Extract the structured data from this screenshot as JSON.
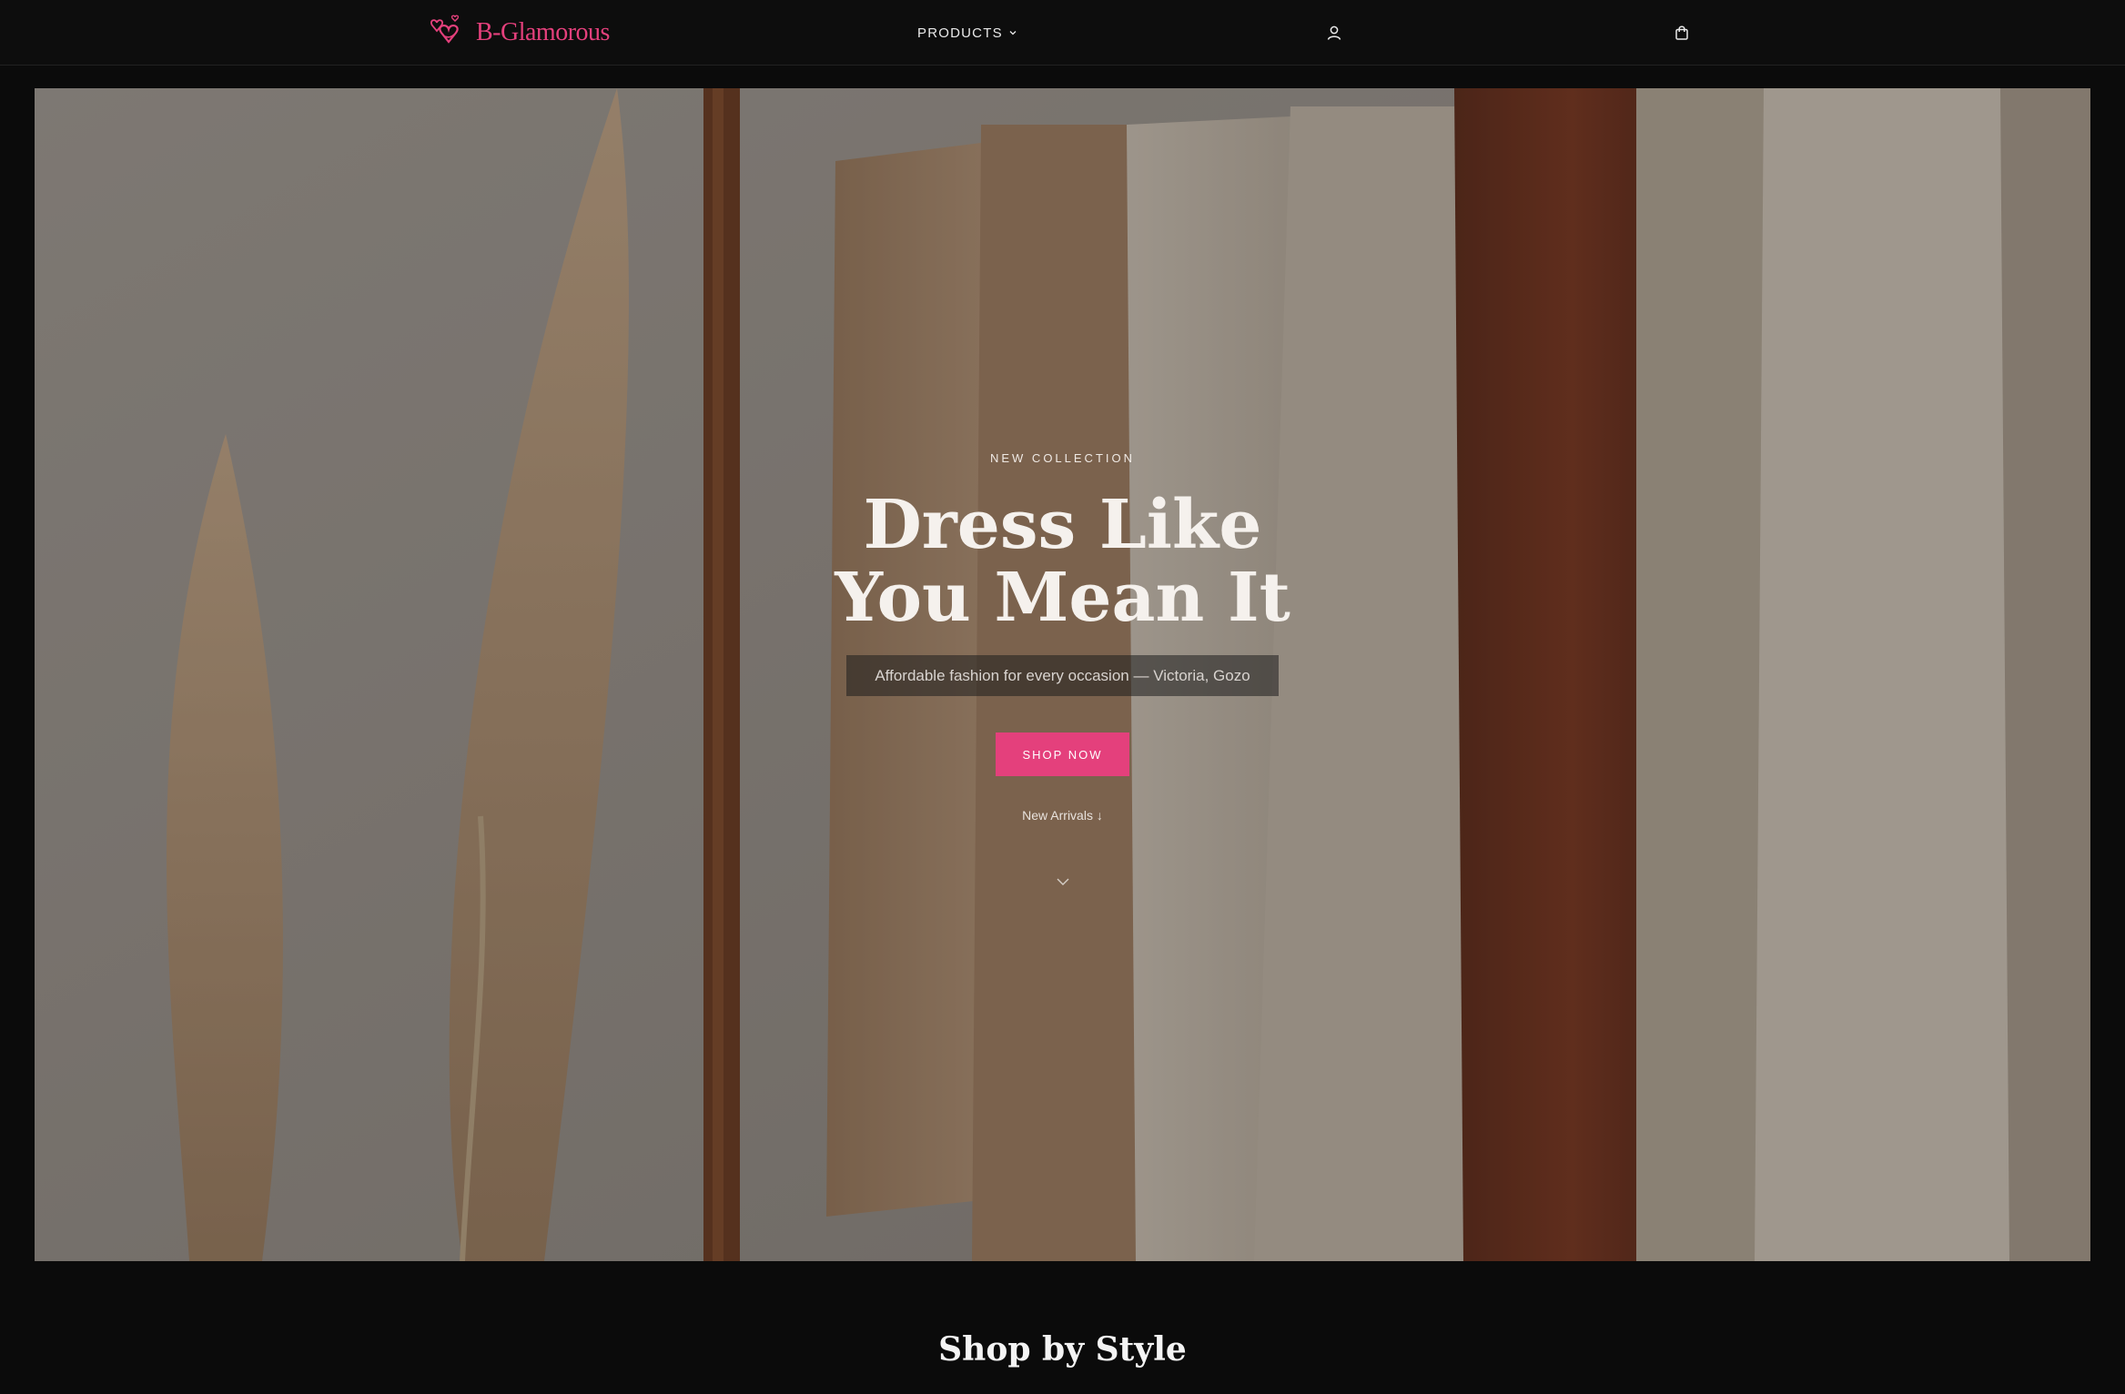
{
  "header": {
    "logo_text": "B-Glamorous",
    "nav_products": "PRODUCTS",
    "account_icon": "user-icon",
    "cart_icon": "shopping-bag-icon"
  },
  "hero": {
    "eyebrow": "NEW COLLECTION",
    "headline_line1": "Dress Like",
    "headline_line2": "You Mean It",
    "tagline": "Affordable fashion for every occasion — Victoria, Gozo",
    "cta_label": "SHOP NOW",
    "secondary_link": "New Arrivals ↓",
    "scroll_icon": "chevron-down-icon"
  },
  "section": {
    "title": "Shop by Style"
  },
  "colors": {
    "accent": "#e4407c",
    "background": "#0b0b0b"
  }
}
